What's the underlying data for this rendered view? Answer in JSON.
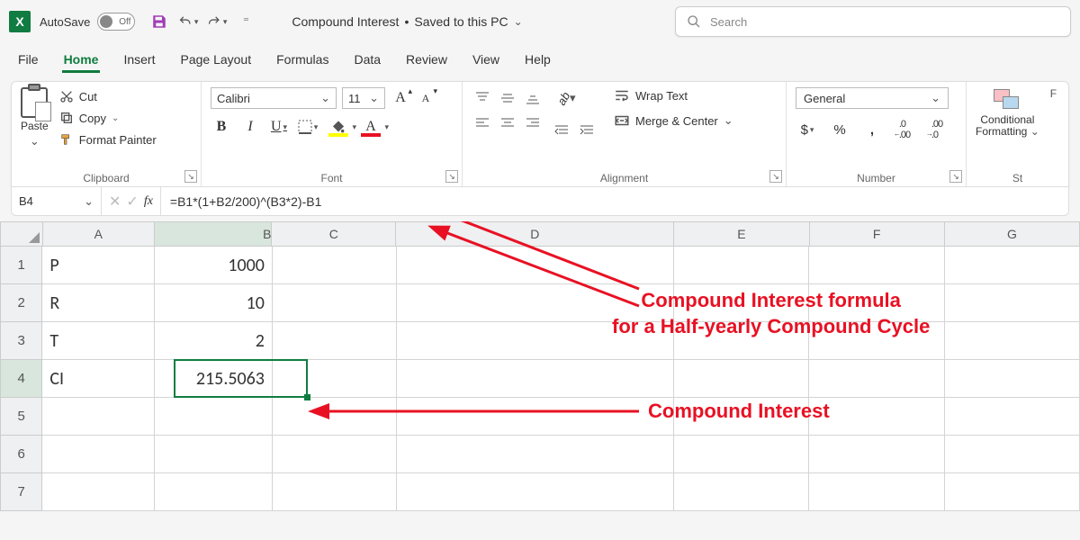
{
  "titlebar": {
    "autosave_label": "AutoSave",
    "autosave_state": "Off",
    "doc_name": "Compound Interest",
    "doc_status": "Saved to this PC",
    "search_placeholder": "Search"
  },
  "tabs": [
    "File",
    "Home",
    "Insert",
    "Page Layout",
    "Formulas",
    "Data",
    "Review",
    "View",
    "Help"
  ],
  "active_tab": "Home",
  "ribbon": {
    "clipboard": {
      "paste": "Paste",
      "cut": "Cut",
      "copy": "Copy",
      "format_painter": "Format Painter",
      "label": "Clipboard"
    },
    "font": {
      "name": "Calibri",
      "size": "11",
      "label": "Font"
    },
    "alignment": {
      "wrap": "Wrap Text",
      "merge": "Merge & Center",
      "label": "Alignment"
    },
    "number": {
      "format": "General",
      "label": "Number"
    },
    "styles": {
      "conditional": "Conditional",
      "formatting": "Formatting",
      "label": "St"
    }
  },
  "formula_bar": {
    "ref": "B4",
    "formula": "=B1*(1+B2/200)^(B3*2)-B1"
  },
  "columns": [
    "A",
    "B",
    "C",
    "D",
    "E",
    "F",
    "G"
  ],
  "rows": [
    "1",
    "2",
    "3",
    "4",
    "5",
    "6",
    "7"
  ],
  "cells": {
    "A1": "P",
    "B1": "1000",
    "A2": "R",
    "B2": "10",
    "A3": "T",
    "B3": "2",
    "A4": "CI",
    "B4": "215.5063"
  },
  "annotations": {
    "formula_note_l1": "Compound Interest formula",
    "formula_note_l2": "for a Half-yearly Compound Cycle",
    "ci_note": "Compound Interest"
  }
}
